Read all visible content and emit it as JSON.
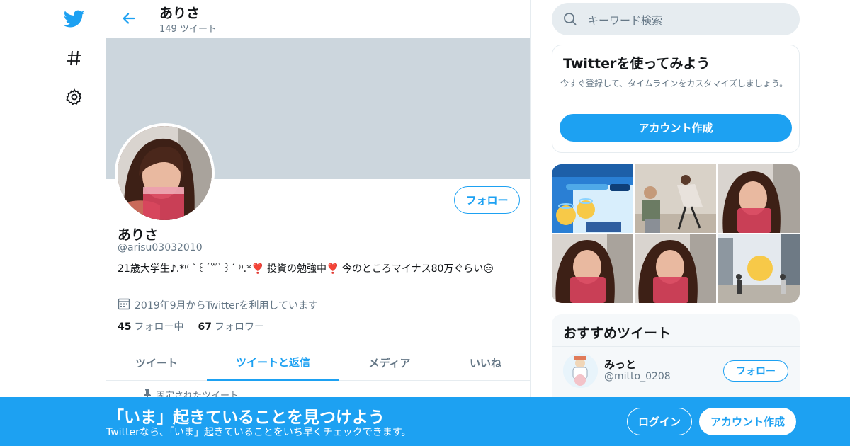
{
  "header": {
    "name": "ありさ",
    "tweet_count": "149 ツイート"
  },
  "profile": {
    "name": "ありさ",
    "handle": "@arisu03032010",
    "bio": "21歳大学生♪.*⁽⁽ ˋ꒰ˊ꒳ˋ꒱ˊ ⁾⁾.*❣️ 投資の勉強中❣️ 今のところマイナス80万ぐらい😑",
    "joined": "2019年9月からTwitterを利用しています",
    "following_count": "45",
    "following_label": "フォロー中",
    "followers_count": "67",
    "followers_label": "フォロワー",
    "follow_button": "フォロー"
  },
  "tabs": [
    {
      "label": "ツイート"
    },
    {
      "label": "ツイートと返信"
    },
    {
      "label": "メディア"
    },
    {
      "label": "いいね"
    }
  ],
  "pinned_label": "固定されたツイート",
  "search": {
    "placeholder": "キーワード検索"
  },
  "signup_card": {
    "title": "Twitterを使ってみよう",
    "description": "今すぐ登録して、タイムラインをカスタマイズしましょう。",
    "button": "アカウント作成"
  },
  "recommended": {
    "title": "おすすめツイート",
    "user": {
      "name": "みっと",
      "handle": "@mitto_0208",
      "follow_button": "フォロー"
    }
  },
  "bottom_bar": {
    "title": "「いま」起きていることを見つけよう",
    "subtitle": "Twitterなら、「いま」起きていることをいち早くチェックできます。",
    "login": "ログイン",
    "signup": "アカウント作成"
  },
  "colors": {
    "accent": "#1da1f2",
    "banner": "#ccd6dd",
    "muted_text": "#657786"
  },
  "icons": [
    "twitter-logo-icon",
    "hashtag-icon",
    "gear-icon",
    "back-arrow-icon",
    "search-icon",
    "calendar-icon",
    "pin-icon"
  ]
}
